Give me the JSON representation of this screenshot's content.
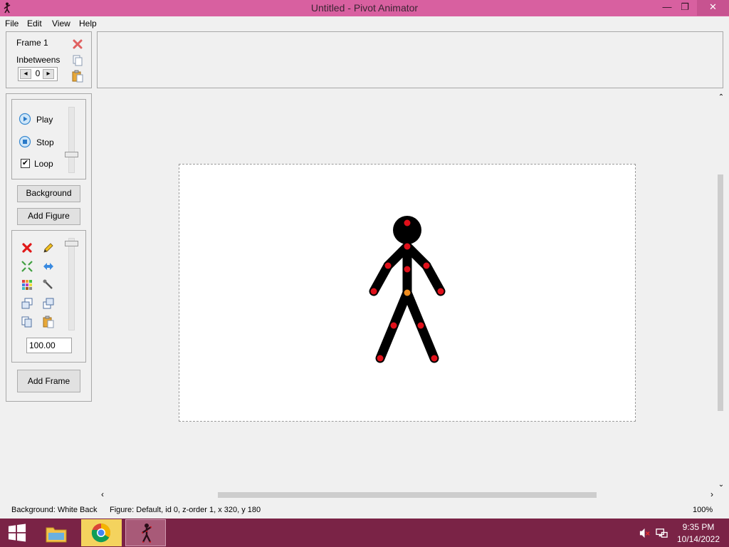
{
  "window": {
    "title": "Untitled - Pivot Animator",
    "minimize_glyph": "—",
    "maximize_glyph": "❐",
    "close_glyph": "✕"
  },
  "menu": [
    "File",
    "Edit",
    "View",
    "Help"
  ],
  "frame_panel": {
    "frame_label": "Frame 1",
    "inbetweens_label": "Inbetweens",
    "inbetweens_value": "0",
    "dec_glyph": "◂",
    "inc_glyph": "▸"
  },
  "playback": {
    "play_label": "Play",
    "stop_label": "Stop",
    "loop_label": "Loop",
    "loop_checked": true
  },
  "buttons": {
    "background": "Background",
    "add_figure": "Add Figure",
    "add_frame": "Add Frame"
  },
  "figure_tools": {
    "icons": [
      "delete-icon",
      "edit-pencil-icon",
      "center-icon",
      "flip-icon",
      "color-icon",
      "tool-icon",
      "bring-front-icon",
      "send-back-icon",
      "copy-icon",
      "paste-icon"
    ],
    "scale_value": "100.00"
  },
  "status": {
    "background": "Background: White Back",
    "figure": "Figure: Default,  id 0,  z-order 1,  x 320, y 180",
    "zoom": "100%"
  },
  "taskbar": {
    "time": "9:35 PM",
    "date": "10/14/2022",
    "items": [
      "windows-start",
      "file-explorer",
      "chrome",
      "pivot-animator"
    ]
  },
  "colors": {
    "titlebar": "#d860a0",
    "taskbar": "#7a2346",
    "joint_red": "#e0101a",
    "joint_orange": "#f08c1e"
  }
}
